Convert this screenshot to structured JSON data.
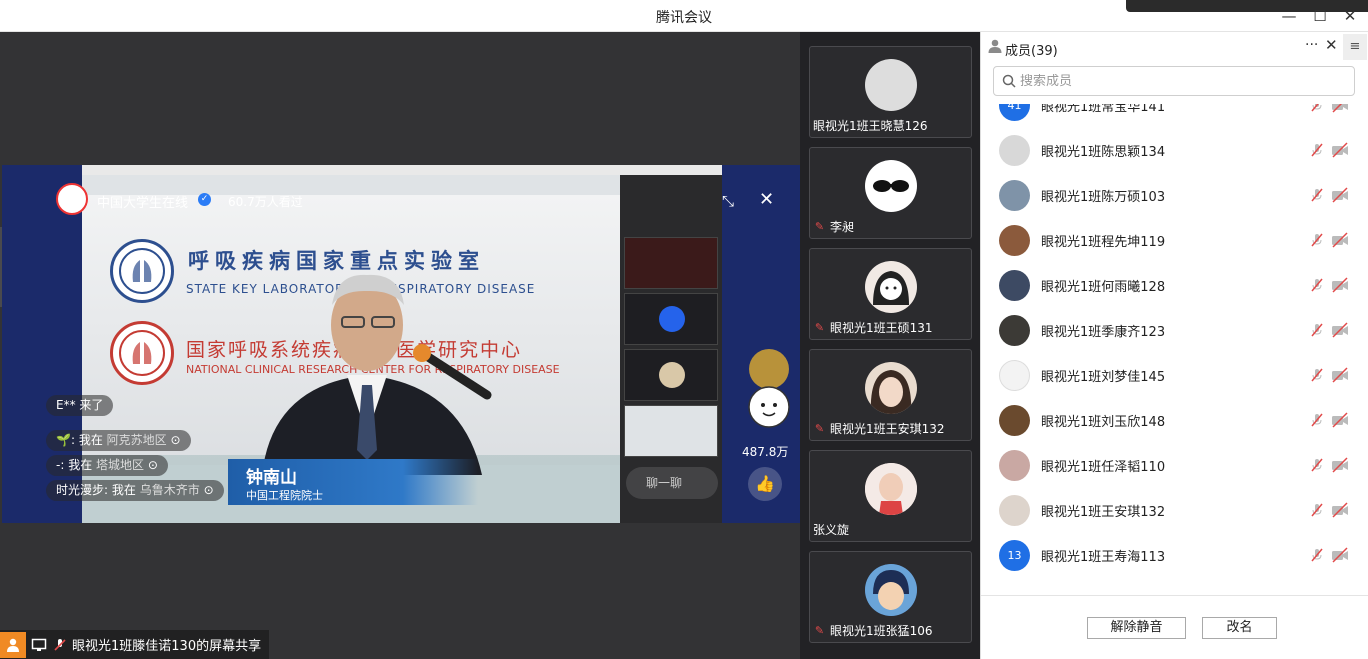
{
  "window": {
    "title": "腾讯会议"
  },
  "stream": {
    "channel_name": "中国大学生在线",
    "viewers": "60.7万人看过",
    "banner_lab_cn": "呼吸疾病国家重点实验室",
    "banner_lab_en": "STATE KEY LABORATORY OF RESPIRATORY DISEASE",
    "banner_center_cn": "国家呼吸系统疾病临床医学研究中心",
    "banner_center_en": "NATIONAL CLINICAL RESEARCH CENTER FOR RESPIRATORY DISEASE",
    "speaker_name": "钟南山",
    "speaker_title": "中国工程院院士",
    "arrival_notice": "E** 来了",
    "locations": [
      {
        "prefix": "🌱:",
        "text": "我在",
        "place": "阿克苏地区"
      },
      {
        "prefix": "-:",
        "text": "我在",
        "place": "塔城地区"
      },
      {
        "prefix": "时光漫步:",
        "text": "我在",
        "place": "乌鲁木齐市"
      }
    ],
    "chat_placeholder": "聊一聊",
    "likes": "487.8万"
  },
  "share_bar": {
    "label": "眼视光1班滕佳诺130的屏幕共享"
  },
  "gallery": [
    {
      "name": "眼视光1班王晓慧126",
      "muted": false,
      "avatar_color": "#e8e8e8"
    },
    {
      "name": "李昶",
      "muted": true,
      "avatar_color": "#ffffff"
    },
    {
      "name": "眼视光1班王硕131",
      "muted": true,
      "avatar_color": "#f1e9e4"
    },
    {
      "name": "眼视光1班王安琪132",
      "muted": true,
      "avatar_color": "#e9dccf"
    },
    {
      "name": "张义旋",
      "muted": false,
      "avatar_color": "#ead6cf"
    },
    {
      "name": "眼视光1班张猛106",
      "muted": true,
      "avatar_color": "#2a4d8a"
    }
  ],
  "members_panel": {
    "title": "成员(39)",
    "search_placeholder": "搜索成员",
    "members": [
      {
        "name": "眼视光1班常宝华141",
        "avatar_text": "41",
        "avatar_color": "#1f6fe5"
      },
      {
        "name": "眼视光1班陈思颖134",
        "avatar_text": "",
        "avatar_color": "#d8d8d8"
      },
      {
        "name": "眼视光1班陈万硕103",
        "avatar_text": "",
        "avatar_color": "#7f93a8"
      },
      {
        "name": "眼视光1班程先坤119",
        "avatar_text": "",
        "avatar_color": "#8b5a3c"
      },
      {
        "name": "眼视光1班何雨曦128",
        "avatar_text": "",
        "avatar_color": "#3d4a63"
      },
      {
        "name": "眼视光1班季康齐123",
        "avatar_text": "",
        "avatar_color": "#3c3a36"
      },
      {
        "name": "眼视光1班刘梦佳145",
        "avatar_text": "",
        "avatar_color": "#f3f3f3"
      },
      {
        "name": "眼视光1班刘玉欣148",
        "avatar_text": "",
        "avatar_color": "#6a4a2e"
      },
      {
        "name": "眼视光1班任泽韬110",
        "avatar_text": "",
        "avatar_color": "#c9a8a3"
      },
      {
        "name": "眼视光1班王安琪132",
        "avatar_text": "",
        "avatar_color": "#ddd4cc"
      },
      {
        "name": "眼视光1班王寿海113",
        "avatar_text": "13",
        "avatar_color": "#1f6fe5"
      }
    ],
    "unmute_button": "解除静音",
    "rename_button": "改名"
  }
}
